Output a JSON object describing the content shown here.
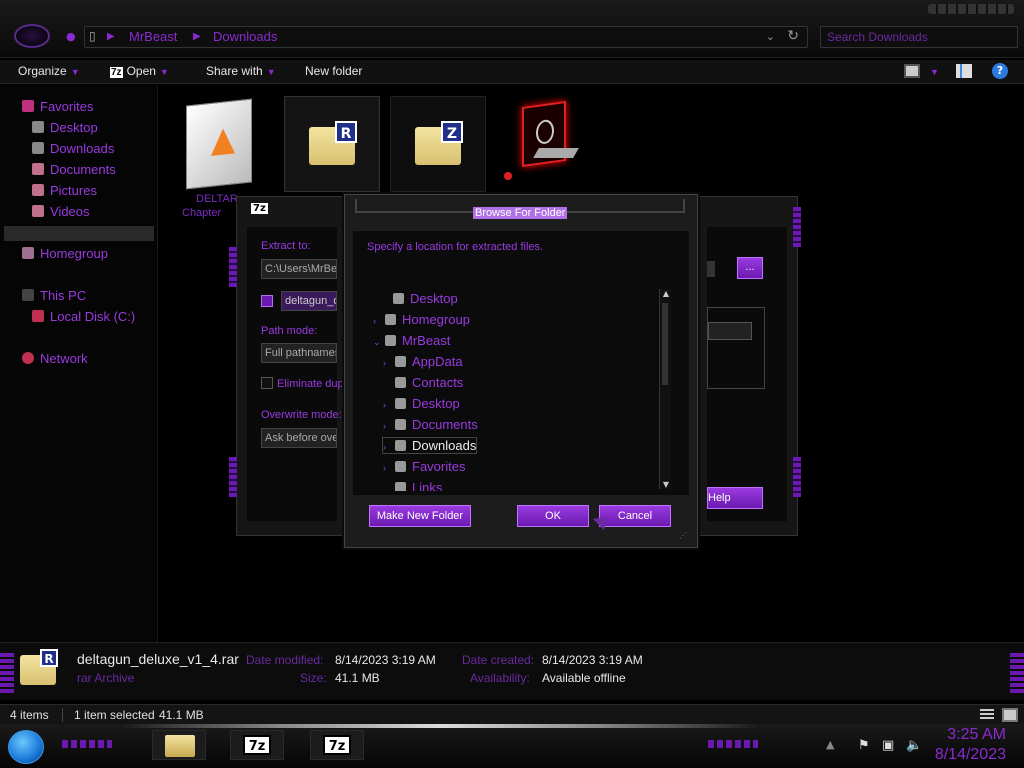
{
  "address": {
    "crumbs": [
      "MrBeast",
      "Downloads"
    ],
    "search_placeholder": "Search Downloads"
  },
  "toolbar": {
    "organize": "Organize",
    "open": "Open",
    "share_with": "Share with",
    "new_folder": "New folder",
    "open_icon_text": "7z"
  },
  "sidebar": {
    "favorites": "Favorites",
    "desktop": "Desktop",
    "downloads": "Downloads",
    "documents": "Documents",
    "pictures": "Pictures",
    "videos": "Videos",
    "homegroup": "Homegroup",
    "this_pc": "This PC",
    "local_disk": "Local Disk (C:)",
    "network": "Network"
  },
  "files": {
    "tile1_label_line1": "DELTAR",
    "tile1_label_line2": "Chapter",
    "tile2_badge": "R",
    "tile3_badge": "Z"
  },
  "zip_dialog": {
    "title_icon": "7z",
    "extract_to": "Extract to:",
    "path": "C:\\Users\\MrBe",
    "archive_name": "deltagun_d",
    "path_mode": "Path mode:",
    "path_mode_value": "Full pathnames",
    "eliminate": "Eliminate dup",
    "overwrite_mode": "Overwrite mode:",
    "overwrite_value": "Ask before ove",
    "browse_btn": "...",
    "help_btn": "Help"
  },
  "browse_dialog": {
    "title": "Browse For Folder",
    "message": "Specify a location for extracted files.",
    "tree": [
      {
        "label": "Desktop",
        "level": 0,
        "arrow": ""
      },
      {
        "label": "Homegroup",
        "level": 1,
        "arrow": "›"
      },
      {
        "label": "MrBeast",
        "level": 1,
        "arrow": "⌄"
      },
      {
        "label": "AppData",
        "level": 2,
        "arrow": "›"
      },
      {
        "label": "Contacts",
        "level": 2,
        "arrow": ""
      },
      {
        "label": "Desktop",
        "level": 2,
        "arrow": "›"
      },
      {
        "label": "Documents",
        "level": 2,
        "arrow": "›"
      },
      {
        "label": "Downloads",
        "level": 2,
        "arrow": "›",
        "selected": true
      },
      {
        "label": "Favorites",
        "level": 2,
        "arrow": "›"
      },
      {
        "label": "Links",
        "level": 2,
        "arrow": ""
      }
    ],
    "make_new_folder": "Make New Folder",
    "ok": "OK",
    "cancel": "Cancel"
  },
  "details": {
    "filename": "deltagun_deluxe_v1_4.rar",
    "type": "rar Archive",
    "date_modified_key": "Date modified:",
    "date_modified": "8/14/2023 3:19 AM",
    "size_key": "Size:",
    "size": "41.1 MB",
    "date_created_key": "Date created:",
    "date_created": "8/14/2023 3:19 AM",
    "availability_key": "Availability:",
    "availability": "Available offline",
    "badge": "R"
  },
  "status": {
    "items": "4 items",
    "selected": "1 item selected",
    "selected_size": "41.1 MB"
  },
  "taskbar": {
    "time": "3:25 AM",
    "date": "8/14/2023",
    "task_7z_1": "7z",
    "task_7z_2": "7z"
  },
  "colors": {
    "accent": "#9a3ae0",
    "background": "#000000",
    "button": "#7a22c8"
  }
}
